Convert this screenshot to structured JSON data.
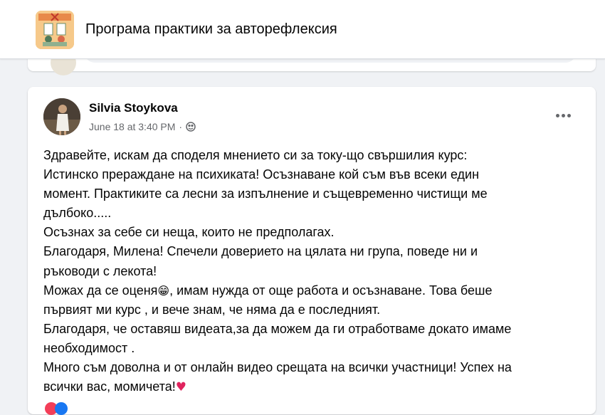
{
  "header": {
    "group_title": "Програма практики за авторефлексия",
    "group_thumb_icon": "group-cover-image"
  },
  "post": {
    "author": "Silvia Stoykova",
    "timestamp": "June 18 at 3:40 PM",
    "separator": "·",
    "privacy_icon": "globe-icon",
    "more_icon": "more-options-icon",
    "lines": [
      "Здравейте, искам да споделя мнението си за току-що свършилия курс:",
      "Истинско прераждане на психиката! Осъзнаване кой съм във всеки един",
      "момент. Практиките са лесни за изпълнение  и същевременно чистищи ме",
      "дълбоко.....",
      "Осъзнах за себе си неща, които не предполагах.",
      "Благодаря, Милена! Спечели доверието на цялата ни група, поведе ни и",
      "ръководи с лекота!",
      "Можах да се оценя",
      ", имам нужда от още работа и осъзнаване. Това беше",
      "първият ми курс , и вече знам, че няма да е последният.",
      "Благодаря, че оставяш видеата,за да можем да ги отработваме докато имаме",
      "необходимост .",
      "Много съм доволна и от онлайн видео срещата на всички участници! Успех на",
      "всички вас, момичета!"
    ],
    "grin_emoji": "😁",
    "heart_emoji": "♥"
  },
  "colors": {
    "background": "#f0f2f5",
    "card": "#ffffff",
    "secondary_text": "#65676b",
    "heart": "#e0245e"
  }
}
